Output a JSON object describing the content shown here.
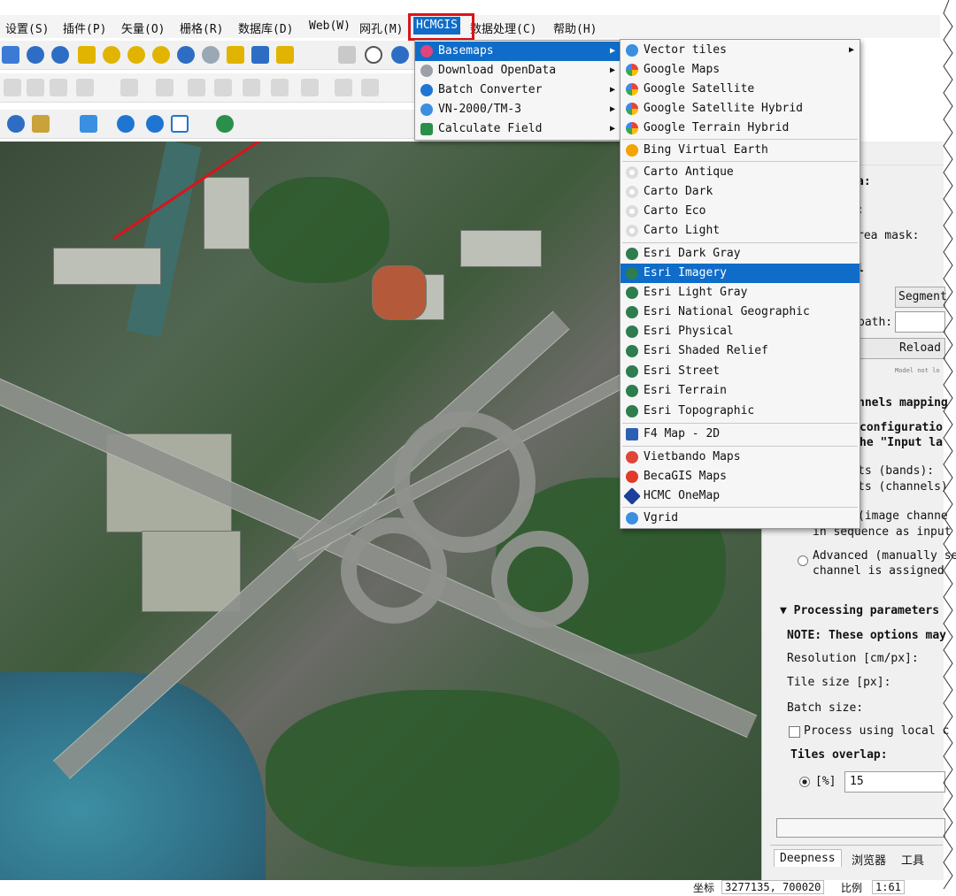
{
  "menubar": {
    "items": [
      "设置(S)",
      "插件(P)",
      "矢量(O)",
      "栅格(R)",
      "数据库(D)",
      "Web(W)",
      "网孔(M)",
      "HCMGIS",
      "数据处理(C)",
      "帮助(H)"
    ]
  },
  "hcmgis_menu": {
    "items": [
      {
        "label": "Basemaps",
        "icon": "basemaps-icon",
        "has_submenu": true,
        "selected": true
      },
      {
        "label": "Download OpenData",
        "icon": "download-icon",
        "has_submenu": true
      },
      {
        "label": "Batch Converter",
        "icon": "converter-icon",
        "has_submenu": true
      },
      {
        "label": "VN-2000/TM-3",
        "icon": "globe-icon",
        "has_submenu": true
      },
      {
        "label": "Calculate Field",
        "icon": "calculator-icon",
        "has_submenu": true
      }
    ]
  },
  "basemaps_submenu": {
    "groups": [
      [
        {
          "label": "Vector tiles",
          "icon": "globe-icon",
          "has_submenu": true
        },
        {
          "label": "Google Maps",
          "icon": "google-icon"
        },
        {
          "label": "Google Satellite",
          "icon": "google-icon"
        },
        {
          "label": "Google Satellite Hybrid",
          "icon": "google-icon"
        },
        {
          "label": "Google Terrain Hybrid",
          "icon": "google-icon"
        }
      ],
      [
        {
          "label": "Bing Virtual Earth",
          "icon": "bing-icon"
        }
      ],
      [
        {
          "label": "Carto Antique",
          "icon": "carto-icon"
        },
        {
          "label": "Carto Dark",
          "icon": "carto-icon"
        },
        {
          "label": "Carto Eco",
          "icon": "carto-icon"
        },
        {
          "label": "Carto Light",
          "icon": "carto-icon"
        }
      ],
      [
        {
          "label": "Esri Dark Gray",
          "icon": "esri-icon"
        },
        {
          "label": "Esri Imagery",
          "icon": "esri-icon",
          "selected": true
        },
        {
          "label": "Esri Light Gray",
          "icon": "esri-icon"
        },
        {
          "label": "Esri National Geographic",
          "icon": "esri-icon"
        },
        {
          "label": "Esri Physical",
          "icon": "esri-icon"
        },
        {
          "label": "Esri Shaded Relief",
          "icon": "esri-icon"
        },
        {
          "label": "Esri Street",
          "icon": "esri-icon"
        },
        {
          "label": "Esri Terrain",
          "icon": "esri-icon"
        },
        {
          "label": "Esri Topographic",
          "icon": "esri-icon"
        }
      ],
      [
        {
          "label": "F4 Map - 2D",
          "icon": "f4-icon"
        }
      ],
      [
        {
          "label": "Vietbando Maps",
          "icon": "vietbando-icon"
        },
        {
          "label": "BecaGIS Maps",
          "icon": "becagis-icon"
        },
        {
          "label": "HCMC OneMap",
          "icon": "onemap-icon"
        }
      ],
      [
        {
          "label": "Vgrid",
          "icon": "globe-icon"
        }
      ]
    ]
  },
  "right_panel": {
    "t1": "a:",
    "t2": ":",
    "area_mask": "rea mask:",
    "l_char": "l",
    "segment_btn": "Segment",
    "path_label": "path:",
    "reload_btn": "Reload",
    "model_note": "Model not lo",
    "channels_heading": "nnels mapping",
    "config_line1": "configuratio",
    "config_line2": "he \"Input la",
    "bands_line": "ts (bands):",
    "channels_line": "ts (channels)",
    "image_channel": "(image channe",
    "sequence_line": "in sequence as input",
    "advanced_line1": "Advanced (manually se",
    "advanced_line2": "channel is assigned",
    "processing_heading": "Processing parameters",
    "note_line": "NOTE: These options may",
    "resolution_label": "Resolution [cm/px]:",
    "tile_size_label": "Tile size [px]:",
    "batch_size_label": "Batch size:",
    "process_local_label": "Process using local c",
    "tiles_overlap_label": "Tiles overlap:",
    "overlap_unit": "[%]",
    "overlap_value": "15"
  },
  "bottom_tabs": {
    "tabs": [
      "Deepness",
      "浏览器",
      "工具"
    ]
  },
  "status_bar": {
    "coords_label": "坐标",
    "coords_value": "3277135, 700020",
    "scale_label": "比例",
    "scale_value": "1:61"
  },
  "colors": {
    "accent": "#0f6cc8",
    "highlight_box": "#d9141a",
    "arrow": "#d9141a"
  }
}
